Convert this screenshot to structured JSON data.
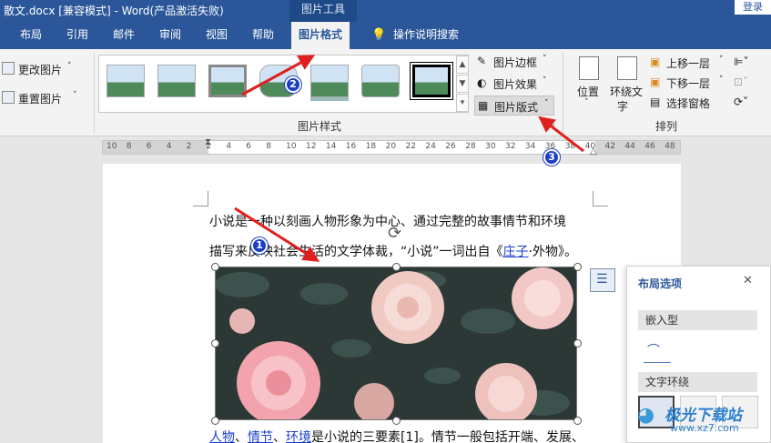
{
  "titlebar": {
    "title": "散文.docx [兼容模式]  -  Word(产品激活失败)",
    "picture_tools": "图片工具",
    "login": "登录"
  },
  "tabs": [
    "布局",
    "引用",
    "邮件",
    "审阅",
    "视图",
    "帮助",
    "图片格式",
    "操作说明搜索"
  ],
  "ribbon": {
    "left": {
      "change_picture": "更改图片",
      "reset_picture": "重置图片"
    },
    "styles_group_label": "图片样式",
    "style_buttons": {
      "border": "图片边框",
      "effects": "图片效果",
      "layout": "图片版式"
    },
    "arrange": {
      "position": "位置",
      "wrap_text_line1": "环绕文",
      "wrap_text_line2": "字",
      "bring_forward": "上移一层",
      "send_backward": "下移一层",
      "selection_pane": "选择窗格",
      "group_label": "排列"
    }
  },
  "ruler": {
    "ticks": [
      "10",
      "8",
      "6",
      "4",
      "2",
      "2",
      "4",
      "6",
      "8",
      "10",
      "12",
      "14",
      "16",
      "18",
      "20",
      "22",
      "24",
      "26",
      "28",
      "30",
      "32",
      "34",
      "36",
      "38",
      "40",
      "42",
      "44",
      "46",
      "48"
    ]
  },
  "document": {
    "line1": "小说是一种以刻画人物形象为中心、通过完整的故事情节和环境",
    "line2_a": "描写来反映社会生活的文学体裁，“小说”一词出自《",
    "line2_link": "庄子",
    "line2_b": "·外物》。",
    "line3_link1": "人物",
    "line3_sep1": "、",
    "line3_link2": "情节",
    "line3_sep2": "、",
    "line3_link3": "环境",
    "line3_b": "是小说的三要素[1]。情节一般包括开端、发展、"
  },
  "layout_pane": {
    "title": "布局选项",
    "close": "✕",
    "inline_section": "嵌入型",
    "wrap_section": "文字环绕"
  },
  "badges": [
    "1",
    "2",
    "3"
  ],
  "watermark": {
    "line1": "极光下载站",
    "line2": "www.xz7.com"
  },
  "colors": {
    "word_blue": "#2b579a",
    "annotation_red": "#e02020",
    "badge_blue": "#1d3fc4",
    "link_blue": "#1a3fc9"
  }
}
